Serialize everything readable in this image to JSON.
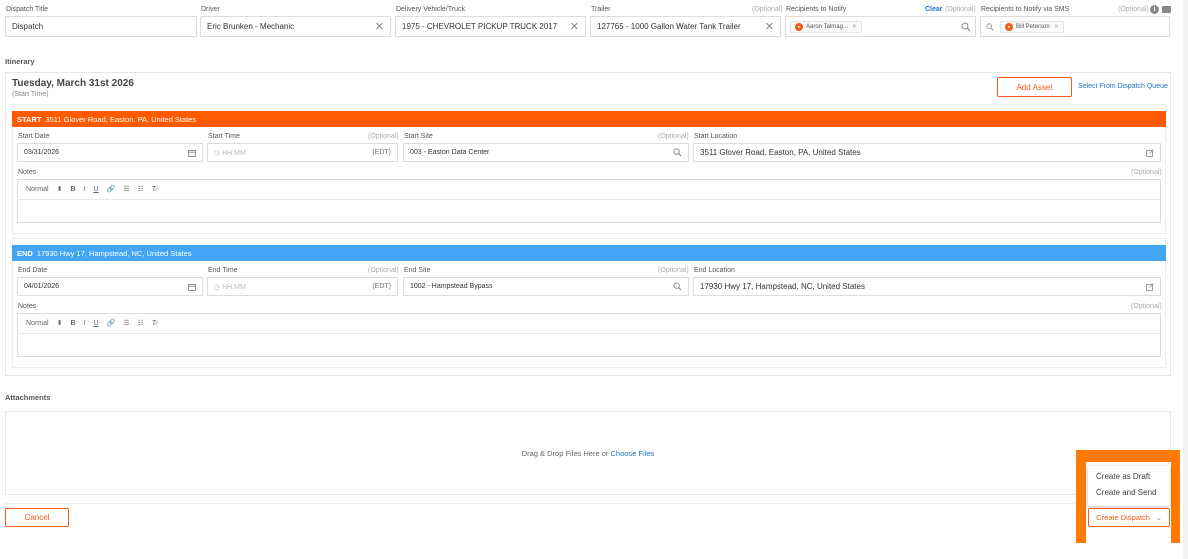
{
  "header": {
    "dispatch_title_label": "Dispatch Title",
    "dispatch_title_value": "Dispatch",
    "driver_label": "Driver",
    "driver_value": "Eric Brunken - Mechanic",
    "vehicle_label": "Delivery Vehicle/Truck",
    "vehicle_value": "1975 - CHEVROLET PICKUP TRUCK 2017",
    "trailer_label": "Trailer",
    "trailer_optional": "(Optional)",
    "trailer_value": "127765 - 1000 Gallon Water Tank Trailer",
    "notify_label": "Recipients to Notify",
    "notify_clear": "Clear",
    "notify_optional": "(Optional)",
    "notify_chip": "Aaron Talmag...",
    "sms_label": "Recipients to Notify via SMS",
    "sms_optional": "(Optional)",
    "sms_chip": "Bill Peterson"
  },
  "itinerary": {
    "label": "Itinerary",
    "date_heading": "Tuesday, March 31st 2026",
    "date_sub": "(Start Time)",
    "add_asset": "Add Asset",
    "select_queue": "Select From Dispatch Queue",
    "start": {
      "bar_tag": "START",
      "bar_address": "3511 Glover Road, Easton, PA, United States",
      "date_label": "Start Date",
      "date_value": "03/31/2026",
      "time_label": "Start Time",
      "time_optional": "(Optional)",
      "time_placeholder": "HH:MM",
      "tz": "(EDT)",
      "site_label": "Start Site",
      "site_optional": "(Optional)",
      "site_value": "003 - Easton Data Center",
      "location_label": "Start Location",
      "location_value": "3511 Glover Road, Easton, PA, United States",
      "notes_label": "Notes",
      "notes_optional": "(Optional)",
      "format": "Normal"
    },
    "end": {
      "bar_tag": "END",
      "bar_address": "17930 Hwy 17, Hampstead, NC, United States",
      "date_label": "End Date",
      "date_value": "04/01/2026",
      "time_label": "End Time",
      "time_optional": "(Optional)",
      "time_placeholder": "HH:MM",
      "tz": "(EDT)",
      "site_label": "End Site",
      "site_optional": "(Optional)",
      "site_value": "1002 - Hampstead Bypass",
      "location_label": "End Location",
      "location_value": "17930 Hwy 17, Hampstead, NC, United States",
      "notes_label": "Notes",
      "notes_optional": "(Optional)",
      "format": "Normal"
    }
  },
  "attachments": {
    "label": "Attachments",
    "drop_text": "Drag & Drop Files Here or",
    "choose": "Choose Files"
  },
  "footer": {
    "cancel": "Cancel",
    "create_dispatch": "Create Dispatch",
    "menu": [
      "Create as Draft",
      "Create and Send"
    ]
  },
  "colors": {
    "start_bar": "#ff5a00",
    "end_bar": "#42a5f5",
    "accent": "#f25a1e",
    "highlight": "#ff7a00",
    "link": "#1e73c8"
  }
}
